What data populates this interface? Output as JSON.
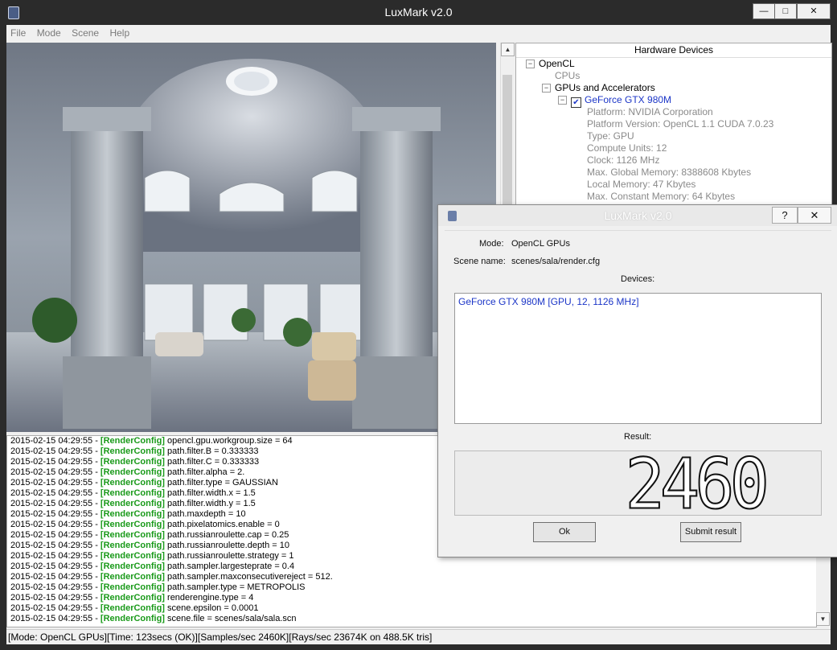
{
  "window": {
    "title": "LuxMark v2.0",
    "btn_minimize": "—",
    "btn_maximize": "□",
    "btn_close": "✕"
  },
  "menu": [
    "File",
    "Mode",
    "Scene",
    "Help"
  ],
  "hardware": {
    "header": "Hardware Devices",
    "opencl": "OpenCL",
    "cpus": "CPUs",
    "gpus_group": "GPUs and Accelerators",
    "device_name": "GeForce GTX 980M",
    "device_checked": true,
    "details": [
      "Platform: NVIDIA Corporation",
      "Platform Version: OpenCL 1.1 CUDA 7.0.23",
      "Type: GPU",
      "Compute Units: 12",
      "Clock: 1126 MHz",
      "Max. Global Memory: 8388608 Kbytes",
      "Local Memory: 47 Kbytes",
      "Max. Constant Memory: 64 Kbytes"
    ]
  },
  "log": {
    "timestamp": "2015-02-15 04:29:55 - ",
    "tag": "[RenderConfig]",
    "lines": [
      "opencl.gpu.workgroup.size = 64",
      "path.filter.B = 0.333333",
      "path.filter.C = 0.333333",
      "path.filter.alpha = 2.",
      "path.filter.type = GAUSSIAN",
      "path.filter.width.x = 1.5",
      "path.filter.width.y = 1.5",
      "path.maxdepth = 10",
      "path.pixelatomics.enable = 0",
      "path.russianroulette.cap = 0.25",
      "path.russianroulette.depth = 10",
      "path.russianroulette.strategy = 1",
      "path.sampler.largesteprate = 0.4",
      "path.sampler.maxconsecutivereject = 512.",
      "path.sampler.type = METROPOLIS",
      "renderengine.type = 4",
      "scene.epsilon = 0.0001",
      "scene.file = scenes/sala/sala.scn"
    ]
  },
  "status": {
    "text": "[Mode: OpenCL GPUs][Time: 123secs (OK)][Samples/sec  2460K][Rays/sec  23674K on 488.5K tris]"
  },
  "dialog": {
    "title": "LuxMark v2.0",
    "help": "?",
    "close": "✕",
    "mode_label": "Mode:",
    "mode_value": "OpenCL GPUs",
    "scene_label": "Scene name:",
    "scene_value": "scenes/sala/render.cfg",
    "devices_label": "Devices:",
    "device_entry": "GeForce GTX 980M [GPU, 12, 1126 MHz]",
    "result_label": "Result:",
    "result_value": "2460",
    "ok_button": "Ok",
    "submit_button": "Submit result"
  }
}
